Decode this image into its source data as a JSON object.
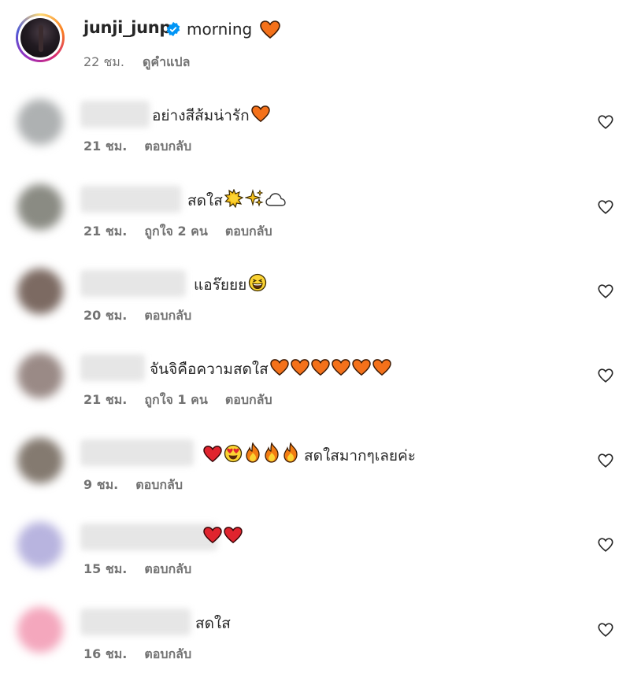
{
  "caption": {
    "username": "junji_junp",
    "text": "morning",
    "time": "22 ชม.",
    "translate": "ดูคำแปล"
  },
  "comments": [
    {
      "text": "อย่างสีส้มน่ารัก",
      "time": "21 ชม.",
      "likes": "",
      "reply": "ตอบกลับ",
      "emoji": [
        "orange-heart"
      ]
    },
    {
      "text": "สดใส",
      "time": "21 ชม.",
      "likes": "ถูกใจ 2 คน",
      "reply": "ตอบกลับ",
      "emoji": [
        "sun",
        "sparkles",
        "cloud"
      ]
    },
    {
      "text": "แอร๊ยยย",
      "time": "20 ชม.",
      "likes": "",
      "reply": "ตอบกลับ",
      "emoji": [
        "grinning-squint-face"
      ]
    },
    {
      "text": "จันจิคือความสดใส",
      "time": "21 ชม.",
      "likes": "ถูกใจ 1 คน",
      "reply": "ตอบกลับ",
      "emoji": [
        "orange-heart",
        "orange-heart",
        "orange-heart",
        "orange-heart",
        "orange-heart",
        "orange-heart"
      ]
    },
    {
      "text": "สดใสมากๆเลยค่ะ",
      "time": "9 ชม.",
      "likes": "",
      "reply": "ตอบกลับ",
      "emoji": [
        "red-heart",
        "heart-eyes",
        "fire",
        "fire",
        "fire"
      ]
    },
    {
      "text": "",
      "time": "15 ชม.",
      "likes": "",
      "reply": "ตอบกลับ",
      "emoji": [
        "red-heart",
        "red-heart"
      ]
    },
    {
      "text": "สดใส",
      "time": "16 ชม.",
      "likes": "",
      "reply": "ตอบกลับ",
      "emoji": []
    }
  ],
  "colors": {
    "orange_heart": "#f4711a",
    "red_heart": "#e0242e",
    "verified": "#0095f6",
    "muted": "#737373"
  }
}
